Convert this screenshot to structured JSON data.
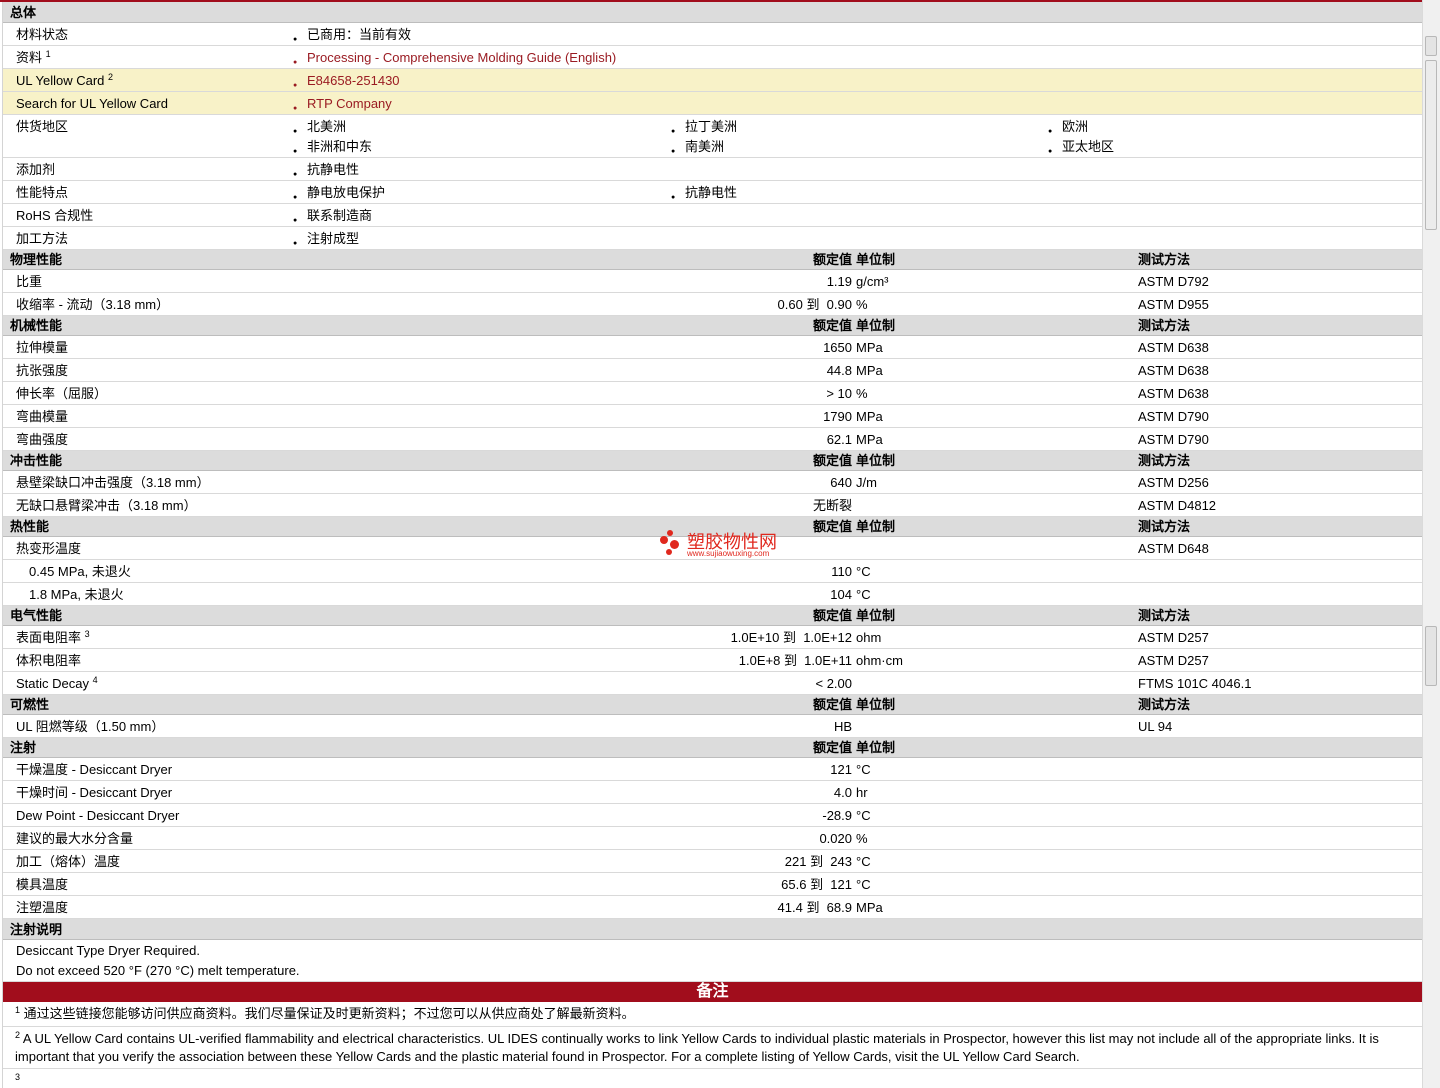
{
  "general": {
    "title": "总体",
    "material_status_label": "材料状态",
    "material_status_value": "已商用：当前有效",
    "docs_label": "资料",
    "docs_sup": "1",
    "docs_value": "Processing - Comprehensive Molding Guide (English)",
    "ul_card_label": "UL Yellow Card",
    "ul_card_sup": "2",
    "ul_card_value": "E84658-251430",
    "search_label": "Search for UL Yellow Card",
    "search_value": "RTP Company",
    "region_label": "供货地区",
    "regions": [
      "北美洲",
      "拉丁美洲",
      "欧洲",
      "非洲和中东",
      "南美洲",
      "亚太地区"
    ],
    "additive_label": "添加剂",
    "additive_value": "抗静电性",
    "features_label": "性能特点",
    "features": [
      "静电放电保护",
      "抗静电性"
    ],
    "rohs_label": "RoHS 合规性",
    "rohs_value": "联系制造商",
    "process_label": "加工方法",
    "process_value": "注射成型"
  },
  "headers": {
    "nominal": "额定值",
    "unit": "单位制",
    "test": "测试方法"
  },
  "sections": [
    {
      "title": "物理性能",
      "header": true,
      "rows": [
        {
          "label": "比重",
          "value": "1.19",
          "unit": "g/cm³",
          "test": "ASTM D792"
        },
        {
          "label": "收缩率 - 流动（3.18 mm）",
          "value": "0.60 到  0.90",
          "unit": "%",
          "test": "ASTM D955"
        }
      ]
    },
    {
      "title": "机械性能",
      "header": true,
      "rows": [
        {
          "label": "拉伸模量",
          "value": "1650",
          "unit": "MPa",
          "test": "ASTM D638"
        },
        {
          "label": "抗张强度",
          "value": "44.8",
          "unit": "MPa",
          "test": "ASTM D638"
        },
        {
          "label": "伸长率（屈服）",
          "value": "> 10",
          "unit": "%",
          "test": "ASTM D638"
        },
        {
          "label": "弯曲模量",
          "value": "1790",
          "unit": "MPa",
          "test": "ASTM D790"
        },
        {
          "label": "弯曲强度",
          "value": "62.1",
          "unit": "MPa",
          "test": "ASTM D790"
        }
      ]
    },
    {
      "title": "冲击性能",
      "header": true,
      "rows": [
        {
          "label": "悬壁梁缺口冲击强度（3.18 mm）",
          "value": "640",
          "unit": "J/m",
          "test": "ASTM D256"
        },
        {
          "label": "无缺口悬臂梁冲击（3.18 mm）",
          "value": "无断裂",
          "unit": "",
          "test": "ASTM D4812"
        }
      ]
    },
    {
      "title": "热性能",
      "header": true,
      "rows": [
        {
          "label": "热变形温度",
          "value": "",
          "unit": "",
          "test": "ASTM D648"
        },
        {
          "label": "0.45 MPa, 未退火",
          "value": "110",
          "unit": "°C",
          "test": "",
          "indent": true
        },
        {
          "label": "1.8 MPa, 未退火",
          "value": "104",
          "unit": "°C",
          "test": "",
          "indent": true
        }
      ]
    },
    {
      "title": "电气性能",
      "header": true,
      "rows": [
        {
          "label": "表面电阻率",
          "sup": "3",
          "value": "1.0E+10 到  1.0E+12",
          "unit": "ohm",
          "test": "ASTM D257"
        },
        {
          "label": "体积电阻率",
          "value": "1.0E+8 到  1.0E+11",
          "unit": "ohm·cm",
          "test": "ASTM D257"
        },
        {
          "label": "Static Decay",
          "sup": "4",
          "value": "< 2.00",
          "unit": "",
          "test": "FTMS 101C 4046.1"
        }
      ]
    },
    {
      "title": "可燃性",
      "header": true,
      "rows": [
        {
          "label": "UL 阻燃等级（1.50 mm）",
          "value": "HB",
          "unit": "",
          "test": "UL 94"
        }
      ]
    },
    {
      "title": "注射",
      "header": true,
      "notest": true,
      "rows": [
        {
          "label": "干燥温度 - Desiccant Dryer",
          "value": "121",
          "unit": "°C",
          "test": ""
        },
        {
          "label": "干燥时间 - Desiccant Dryer",
          "value": "4.0",
          "unit": "hr",
          "test": ""
        },
        {
          "label": "Dew Point - Desiccant Dryer",
          "value": "-28.9",
          "unit": "°C",
          "test": ""
        },
        {
          "label": "建议的最大水分含量",
          "value": "0.020",
          "unit": "%",
          "test": ""
        },
        {
          "label": "加工（熔体）温度",
          "value": "221 到  243",
          "unit": "°C",
          "test": ""
        },
        {
          "label": "模具温度",
          "value": "65.6 到  121",
          "unit": "°C",
          "test": ""
        },
        {
          "label": "注塑温度",
          "value": "41.4 到  68.9",
          "unit": "MPa",
          "test": ""
        }
      ]
    }
  ],
  "injection_notes": {
    "title": "注射说明",
    "lines": [
      "Desiccant Type Dryer Required.",
      "Do not exceed 520 °F (270 °C) melt temperature."
    ]
  },
  "remarks": {
    "title": "备注",
    "notes": [
      {
        "num": "1",
        "text": "通过这些链接您能够访问供应商资料。我们尽量保证及时更新资料；不过您可以从供应商处了解最新资料。"
      },
      {
        "num": "2",
        "text": "A UL Yellow Card contains UL-verified flammability and electrical characteristics. UL IDES continually works to link Yellow Cards to individual plastic materials in Prospector, however this list may not include all of the appropriate links. It is important that you verify the association between these Yellow Cards and the plastic material found in Prospector. For a complete listing of Yellow Cards, visit the UL Yellow Card Search."
      },
      {
        "num": "3",
        "text": ""
      }
    ]
  },
  "watermark": {
    "text": "塑胶物性网",
    "url": "www.sujiaowuxing.com"
  }
}
